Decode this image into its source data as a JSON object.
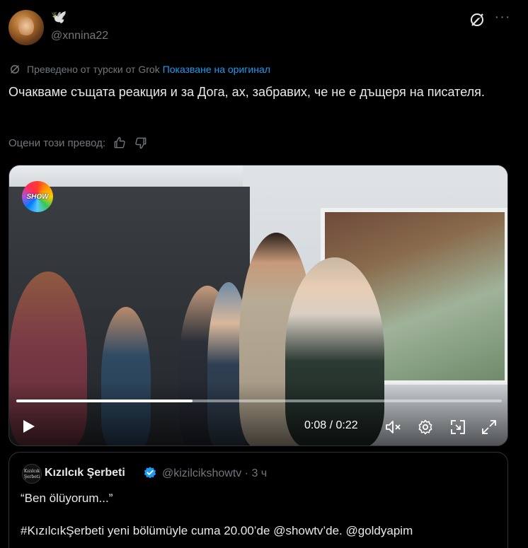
{
  "author": {
    "display_name": "🕊️",
    "handle": "@xnnina22"
  },
  "translation": {
    "label": "Преведено от турски от Grok",
    "show_original": "Показване на оригинал"
  },
  "tweet": {
    "text": "Очакваме същата реакция и за Дога, ах, забравих, че не е дъщеря на писателя."
  },
  "rating": {
    "label": "Оцени този превод:"
  },
  "video": {
    "channel_logo": "SHOW",
    "time": "0:08 / 0:22",
    "progress": 0.363,
    "icons": [
      "play-icon",
      "mute-icon",
      "settings-icon",
      "pip-icon",
      "fullscreen-icon"
    ]
  },
  "quoted": {
    "avatar_text": "Kızılcık Şerbeti",
    "name": "Kızılcık Şerbeti",
    "handle_time": "@kizilcikshowtv · 3 ч",
    "line1": "“Ben ölüyorum...”",
    "line2": "#KızılcıkŞerbeti yeni bölümüyle cuma 20.00’de @showtv’de. @goldyapim"
  },
  "colors": {
    "link": "#1d9bf0",
    "muted": "#71767b",
    "verified": "#1d9bf0"
  }
}
